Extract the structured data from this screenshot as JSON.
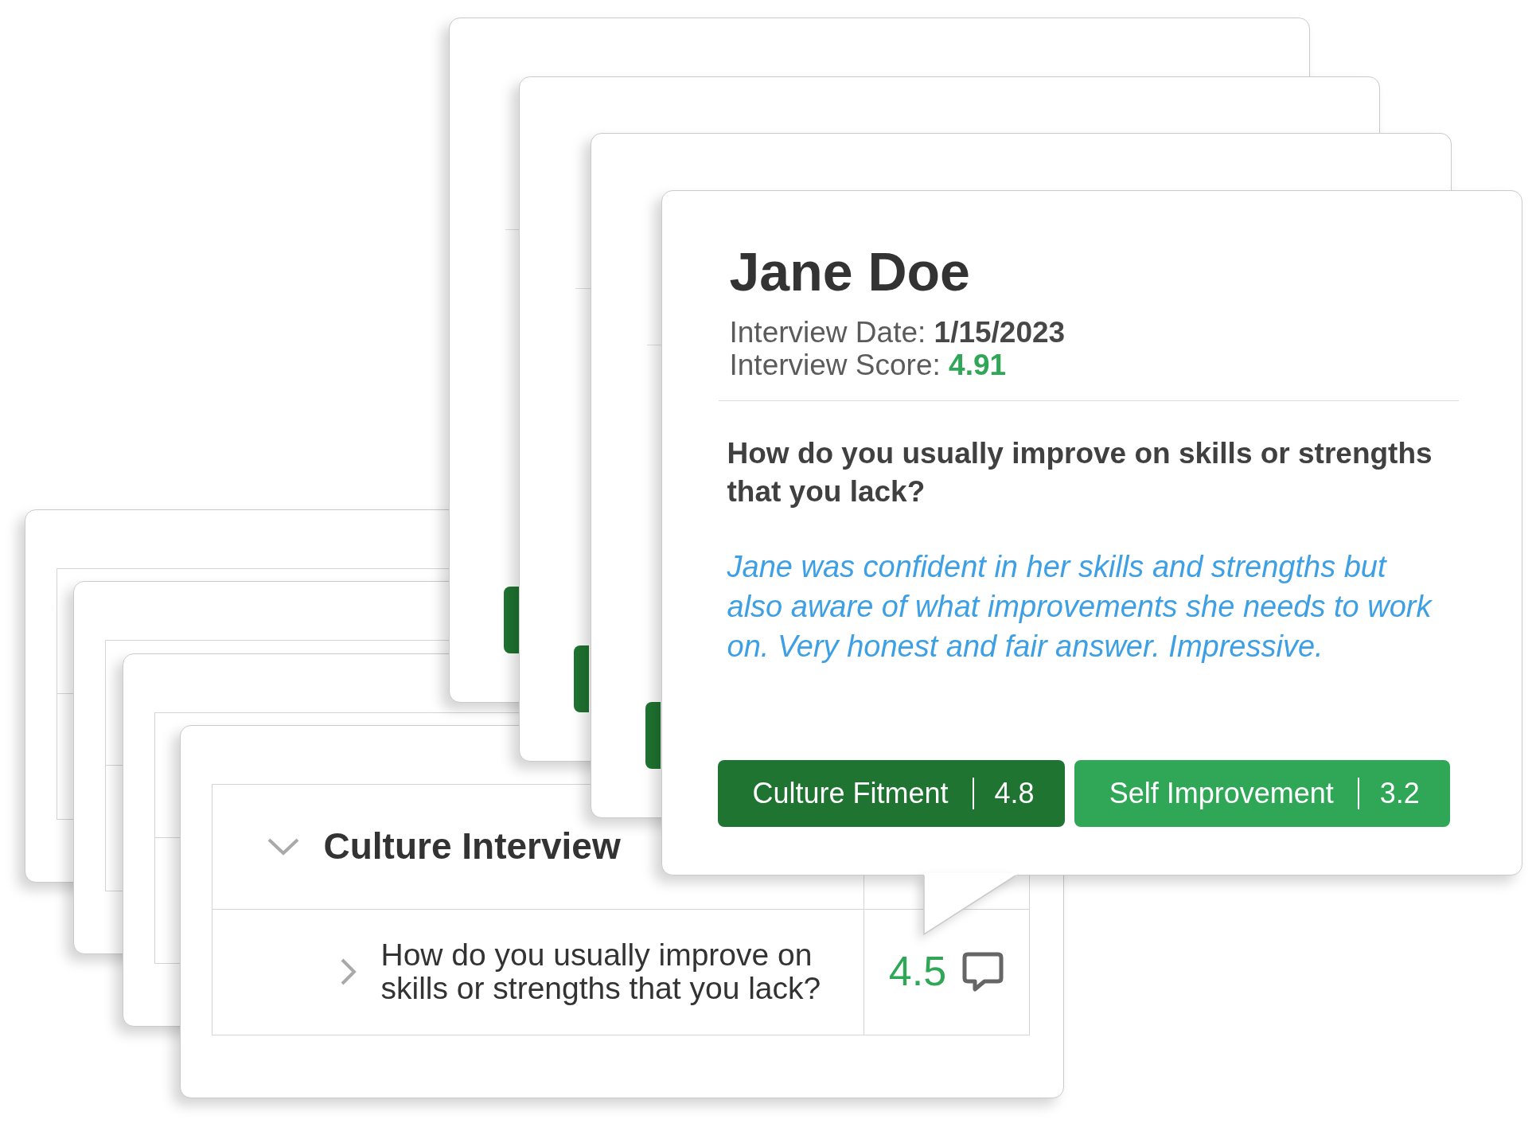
{
  "background_cards": [
    {
      "kind": "table"
    },
    {
      "kind": "table"
    },
    {
      "kind": "table"
    },
    {
      "kind": "popover"
    },
    {
      "kind": "popover"
    },
    {
      "kind": "popover"
    }
  ],
  "interview_card": {
    "section": {
      "title": "Culture Interview",
      "expanded": true
    },
    "questions": [
      {
        "text": "How do you usually improve on skills or strengths that you lack?",
        "expanded": false,
        "score": "4.5"
      }
    ]
  },
  "review_popover": {
    "name": "Jane Doe",
    "details": [
      {
        "kind": "date",
        "label": "Interview Date:",
        "value": "1/15/2023"
      },
      {
        "kind": "score",
        "label": "Interview Score:",
        "value": "4.91"
      }
    ],
    "question": "How do you usually improve on skills or strengths that you lack?",
    "comment": "Jane was confident in her skills and strengths but also aware of what improvements she needs to work on. Very honest and fair answer. Impressive.",
    "categories": [
      {
        "label": "Culture Fitment",
        "score": "4.8",
        "color": "#1f7431"
      },
      {
        "label": "Self Improvement",
        "score": "3.2",
        "color": "#2fa757"
      }
    ]
  }
}
